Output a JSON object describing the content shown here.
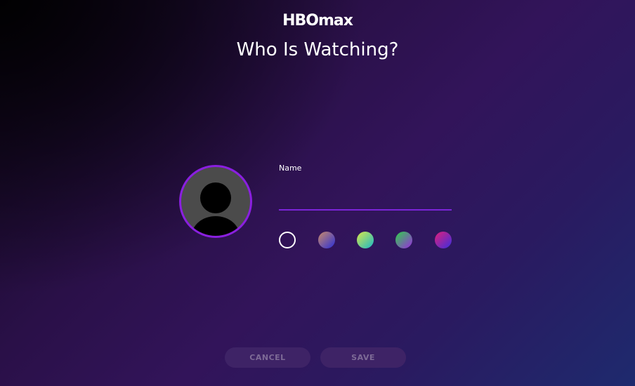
{
  "brand": {
    "logo_text": "HBOmax"
  },
  "header": {
    "title": "Who Is Watching?"
  },
  "profile": {
    "avatar_icon": "person-silhouette-icon",
    "avatar_border_color": "#8a1fe0",
    "name_label": "Name",
    "name_value": "",
    "name_placeholder": ""
  },
  "colors": {
    "selected_index": 0,
    "swatches": [
      {
        "name": "none",
        "gradient": [
          "transparent",
          "transparent"
        ]
      },
      {
        "name": "rose-blue",
        "gradient": [
          "#c98a6a",
          "#2b2fd6"
        ]
      },
      {
        "name": "lime-teal",
        "gradient": [
          "#d9e64a",
          "#19b8c8"
        ]
      },
      {
        "name": "green-purple",
        "gradient": [
          "#2fd04a",
          "#9a2be0"
        ]
      },
      {
        "name": "magenta-blue",
        "gradient": [
          "#e0207a",
          "#3a2ee0"
        ]
      }
    ]
  },
  "actions": {
    "cancel_label": "CANCEL",
    "save_label": "SAVE"
  }
}
